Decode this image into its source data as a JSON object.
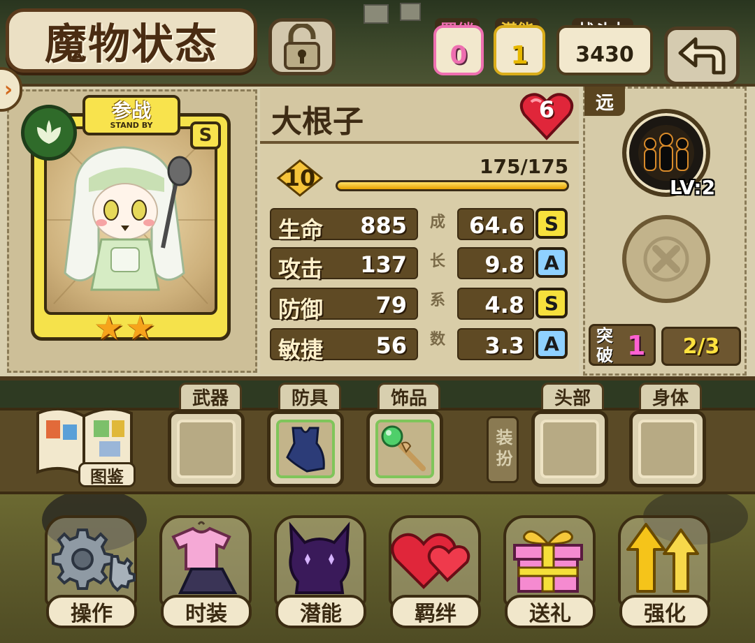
{
  "header": {
    "title": "魔物状态",
    "stats": [
      {
        "label": "羁绊",
        "value": "0",
        "color": "#ee6fb0"
      },
      {
        "label": "潜能",
        "value": "1",
        "color": "#f0c83a"
      },
      {
        "label": "战斗力",
        "value": "3430",
        "color": "#ffffff"
      }
    ]
  },
  "card": {
    "standby_main": "参战",
    "standby_sub": "STAND BY",
    "rank": "S",
    "stars": 2,
    "element_icon": "leaf-icon"
  },
  "monster": {
    "name": "大根子",
    "affection": "6",
    "level": "10",
    "exp_text": "175/175",
    "exp_progress": 1.0
  },
  "stats": [
    {
      "label": "生命",
      "value": "885",
      "growth": "64.6",
      "grade": "S"
    },
    {
      "label": "攻击",
      "value": "137",
      "growth": "9.8",
      "grade": "A"
    },
    {
      "label": "防御",
      "value": "79",
      "growth": "4.8",
      "grade": "S"
    },
    {
      "label": "敏捷",
      "value": "56",
      "growth": "3.3",
      "grade": "A"
    }
  ],
  "growth_label_chars": [
    "成",
    "长",
    "系",
    "数"
  ],
  "skill": {
    "range": "远",
    "level": "LV:2"
  },
  "breakthrough": {
    "label": "突破",
    "count": "1",
    "progress": "2/3"
  },
  "equipment": {
    "slots": [
      {
        "label": "武器",
        "filled": false
      },
      {
        "label": "防具",
        "filled": true,
        "item": "armor-icon"
      },
      {
        "label": "饰品",
        "filled": true,
        "item": "kendama-icon"
      }
    ],
    "dressup_label": "装扮",
    "dressup_slots": [
      {
        "label": "头部",
        "filled": false
      },
      {
        "label": "身体",
        "filled": false
      }
    ],
    "book_label": "图鉴"
  },
  "actions": [
    {
      "label": "操作",
      "icon": "gear-icon"
    },
    {
      "label": "时装",
      "icon": "outfit-icon"
    },
    {
      "label": "潜能",
      "icon": "demon-icon"
    },
    {
      "label": "羁绊",
      "icon": "hearts-icon"
    },
    {
      "label": "送礼",
      "icon": "gift-icon"
    },
    {
      "label": "强化",
      "icon": "upgrade-arrows-icon"
    }
  ]
}
